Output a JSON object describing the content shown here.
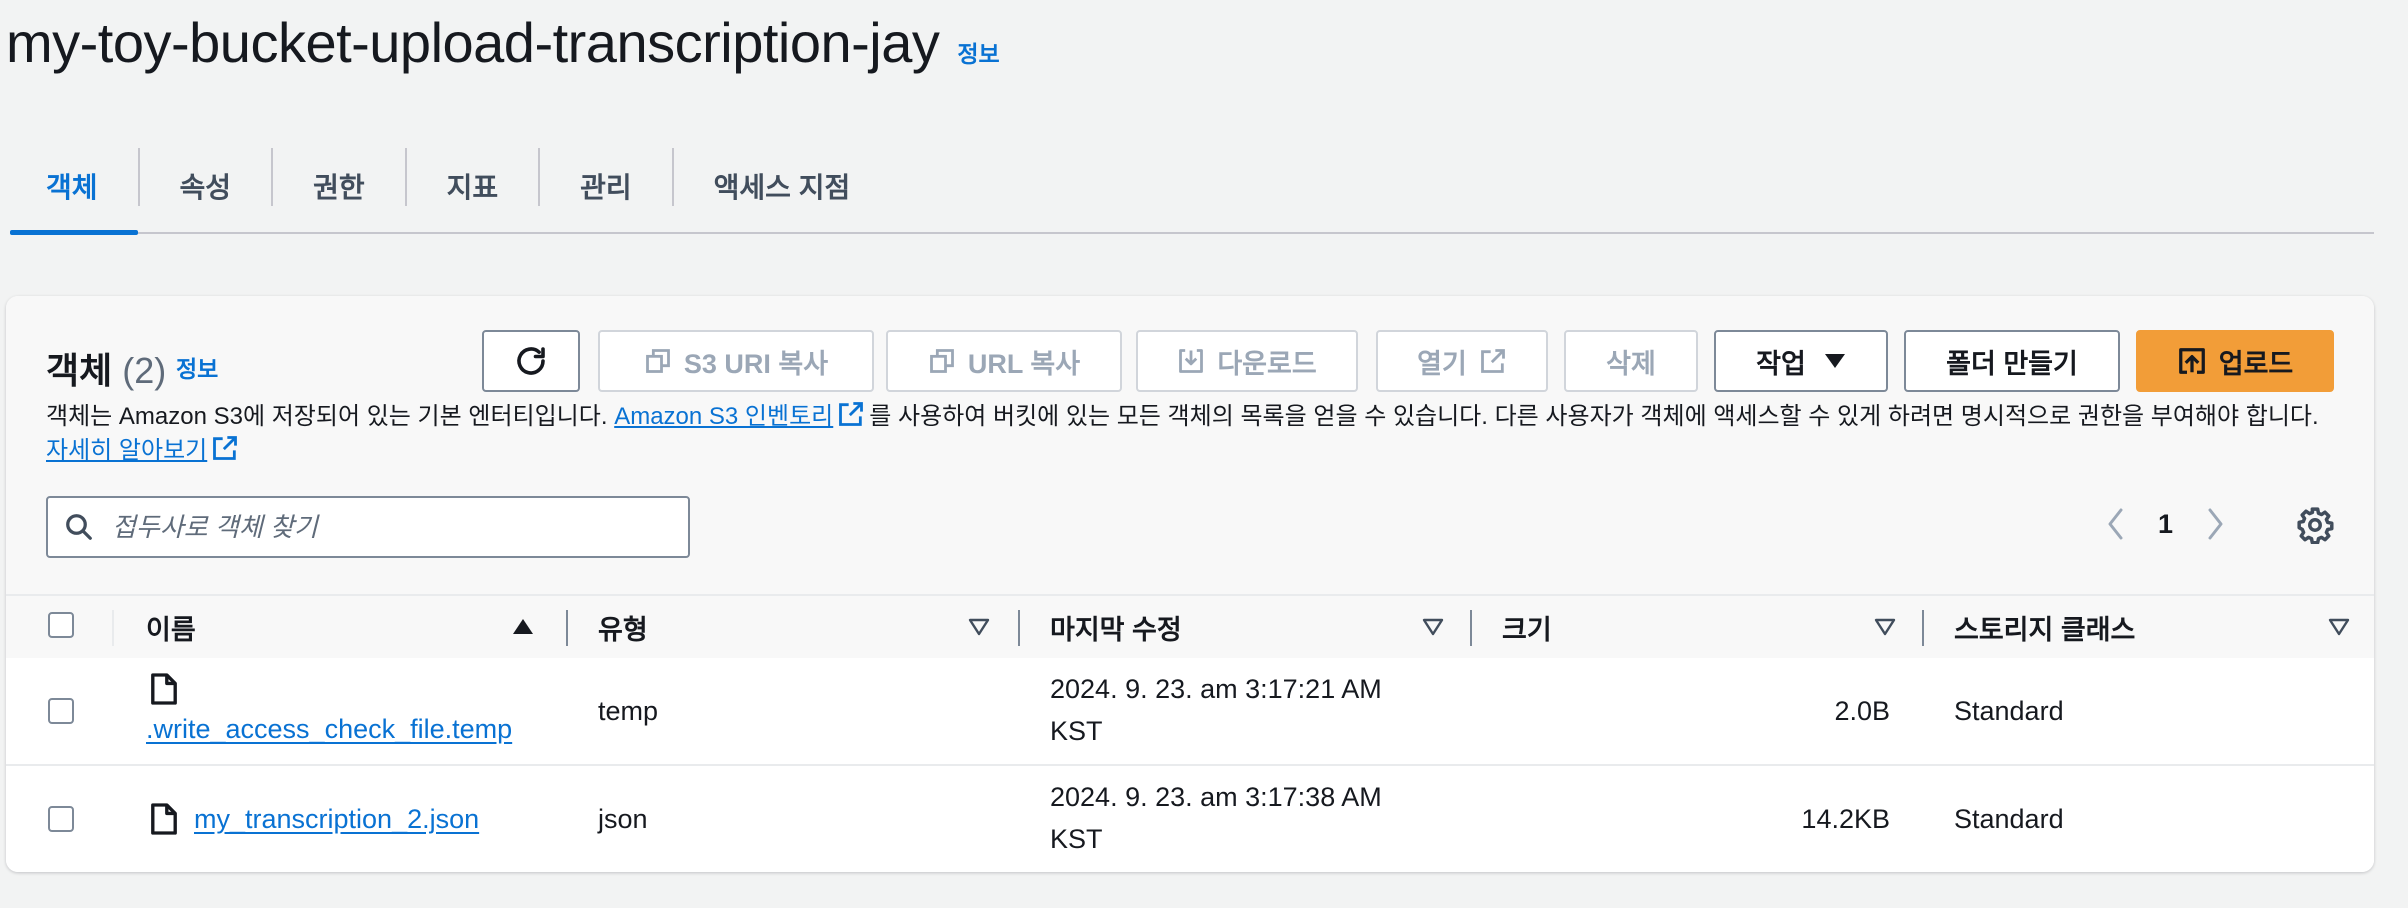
{
  "header": {
    "title": "my-toy-bucket-upload-transcription-jay",
    "info": "정보"
  },
  "tabs": [
    {
      "label": "객체",
      "active": true
    },
    {
      "label": "속성"
    },
    {
      "label": "권한"
    },
    {
      "label": "지표"
    },
    {
      "label": "관리"
    },
    {
      "label": "액세스 지점"
    }
  ],
  "objects": {
    "title": "객체",
    "count": "(2)",
    "info": "정보",
    "description_before": "객체는 Amazon S3에 저장되어 있는 기본 엔터티입니다. ",
    "inventory_link": "Amazon S3 인벤토리",
    "description_after": "를 사용하여 버킷에 있는 모든 객체의 목록을 얻을 수 있습니다. 다른 사용자가 객체에 액세스할 수 있게 하려면 명시적으로 권한을 부여해야 합니다. ",
    "learn_more_link": "자세히 알아보기"
  },
  "toolbar": {
    "copy_s3_uri": "S3 URI 복사",
    "copy_url": "URL 복사",
    "download": "다운로드",
    "open": "열기",
    "delete": "삭제",
    "actions": "작업",
    "create_folder": "폴더 만들기",
    "upload": "업로드"
  },
  "search": {
    "placeholder": "접두사로 객체 찾기"
  },
  "pagination": {
    "current_page": "1"
  },
  "table": {
    "columns": [
      "이름",
      "유형",
      "마지막 수정",
      "크기",
      "스토리지 클래스"
    ],
    "rows": [
      {
        "name": ".write_access_check_file.temp",
        "type": "temp",
        "modified_line1": "2024. 9. 23. am 3:17:21 AM",
        "modified_line2": "KST",
        "size": "2.0B",
        "storage_class": "Standard"
      },
      {
        "name": "my_transcription_2.json",
        "type": "json",
        "modified_line1": "2024. 9. 23. am 3:17:38 AM",
        "modified_line2": "KST",
        "size": "14.2KB",
        "storage_class": "Standard"
      }
    ]
  },
  "colors": {
    "link": "#0972d3",
    "primary_button": "#f29d38",
    "text": "#16191f",
    "background": "#f2f3f3"
  },
  "icons": [
    "refresh-icon",
    "copy-icon",
    "download-icon",
    "external-link-icon",
    "caret-down-icon",
    "upload-icon",
    "search-icon",
    "chevron-left-icon",
    "chevron-right-icon",
    "gear-icon",
    "sort-ascending-icon",
    "sort-icon",
    "file-icon"
  ]
}
